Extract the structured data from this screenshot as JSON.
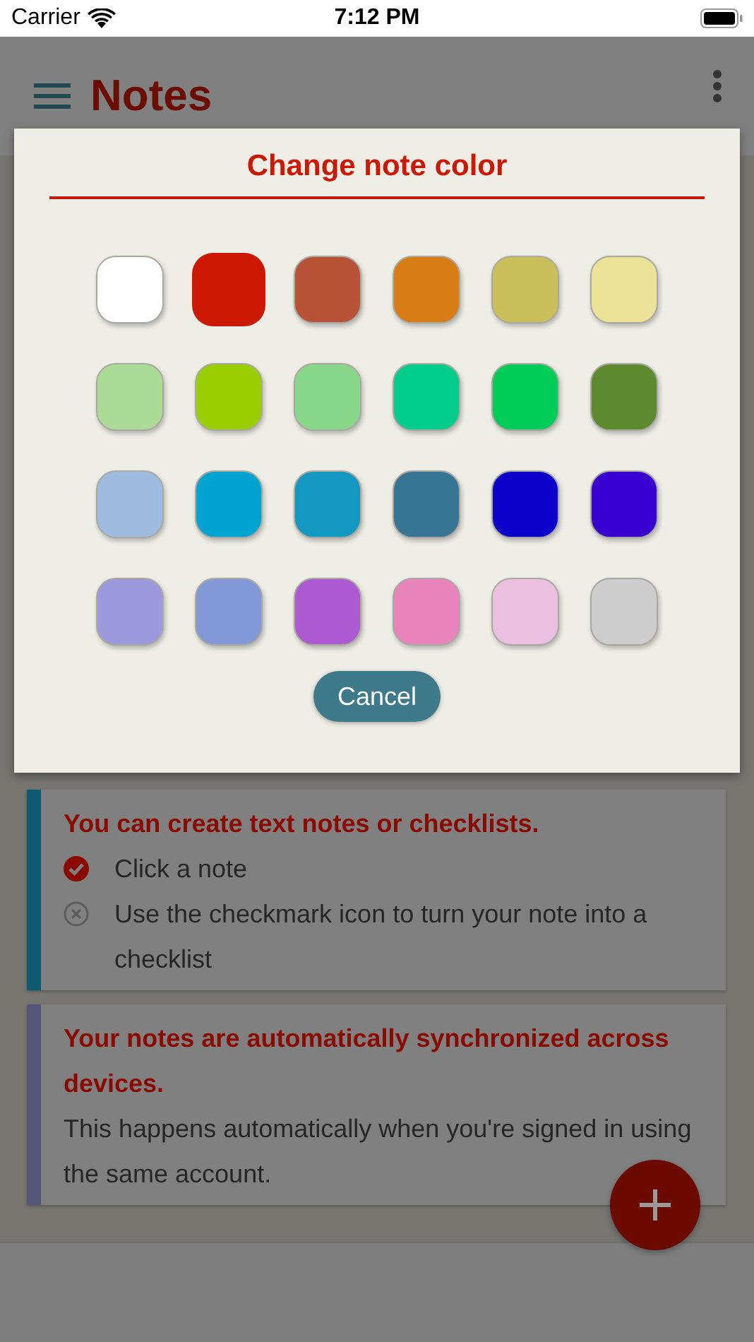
{
  "status_bar": {
    "carrier": "Carrier",
    "time": "7:12 PM"
  },
  "header": {
    "title": "Notes"
  },
  "dialog": {
    "title": "Change note color",
    "colors": [
      {
        "color": "#ffffff",
        "selected": false
      },
      {
        "color": "#cc1800",
        "selected": true
      },
      {
        "color": "#b85236",
        "selected": false
      },
      {
        "color": "#d87c14",
        "selected": false
      },
      {
        "color": "#cbbf5b",
        "selected": false
      },
      {
        "color": "#ece398",
        "selected": false
      },
      {
        "color": "#abdb96",
        "selected": false
      },
      {
        "color": "#99cf00",
        "selected": false
      },
      {
        "color": "#88d68a",
        "selected": false
      },
      {
        "color": "#00cd8c",
        "selected": false
      },
      {
        "color": "#00cd58",
        "selected": false
      },
      {
        "color": "#5d8a2f",
        "selected": false
      },
      {
        "color": "#9fbbe0",
        "selected": false
      },
      {
        "color": "#00a4d0",
        "selected": false
      },
      {
        "color": "#1398c2",
        "selected": false
      },
      {
        "color": "#387594",
        "selected": false
      },
      {
        "color": "#0c00cc",
        "selected": false
      },
      {
        "color": "#3a00d0",
        "selected": false
      },
      {
        "color": "#9c99dc",
        "selected": false
      },
      {
        "color": "#8398d6",
        "selected": false
      },
      {
        "color": "#ab5ad2",
        "selected": false
      },
      {
        "color": "#e985bc",
        "selected": false
      },
      {
        "color": "#eabfe0",
        "selected": false
      },
      {
        "color": "#cdcdcd",
        "selected": false
      }
    ],
    "cancel": "Cancel"
  },
  "notes": [
    {
      "color": "#0e5a70",
      "title": "You can create text notes or checklists.",
      "items": [
        {
          "text": "Click a note",
          "checked": true
        },
        {
          "text": "Use the checkmark icon to turn your note into a checklist",
          "checked": false
        }
      ]
    },
    {
      "color": "#555579",
      "title": "Your notes are automatically synchronized across devices.",
      "body": "This happens automatically when you're signed in using the same account."
    }
  ]
}
